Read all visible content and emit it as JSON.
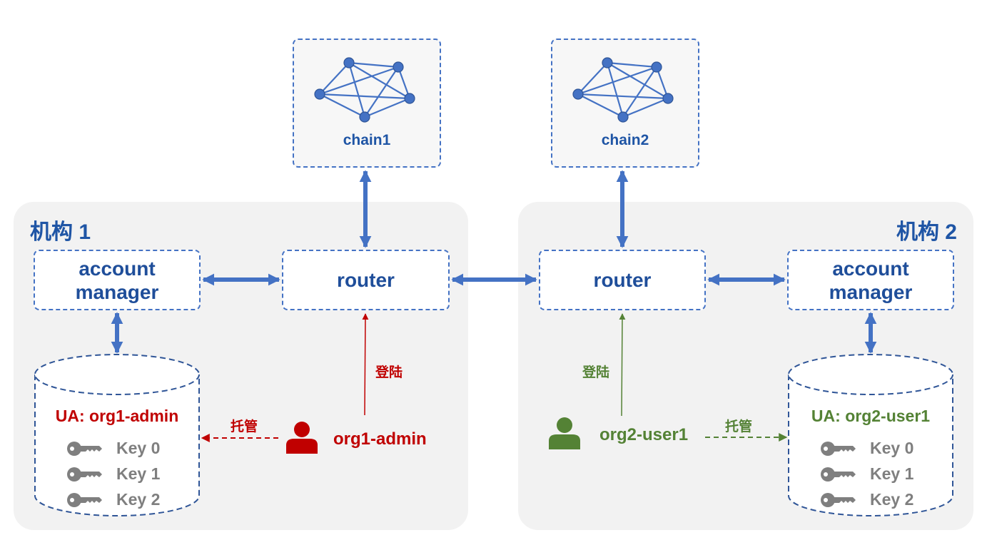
{
  "colors": {
    "primary_blue": "#4472c4",
    "text_blue": "#1f55a5",
    "org1_red": "#c00000",
    "org2_green": "#548235",
    "key_gray": "#7f7f7f",
    "panel_bg": "#f2f2f2"
  },
  "chains": [
    {
      "label": "chain1",
      "icon": "network-graph-icon"
    },
    {
      "label": "chain2",
      "icon": "network-graph-icon"
    }
  ],
  "orgs": [
    {
      "title": "机构 1",
      "router_label": "router",
      "account_manager_label": [
        "account",
        "manager"
      ],
      "user": {
        "name": "org1-admin",
        "icon": "user-icon",
        "color": "#c00000"
      },
      "login_label": "登陆",
      "custody_label": "托管",
      "ua": {
        "title": "UA: org1-admin",
        "keys": [
          {
            "label": "Key 0",
            "icon": "key-icon"
          },
          {
            "label": "Key 1",
            "icon": "key-icon"
          },
          {
            "label": "Key 2",
            "icon": "key-icon"
          }
        ]
      }
    },
    {
      "title": "机构 2",
      "router_label": "router",
      "account_manager_label": [
        "account",
        "manager"
      ],
      "user": {
        "name": "org2-user1",
        "icon": "user-icon",
        "color": "#548235"
      },
      "login_label": "登陆",
      "custody_label": "托管",
      "ua": {
        "title": "UA: org2-user1",
        "keys": [
          {
            "label": "Key 0",
            "icon": "key-icon"
          },
          {
            "label": "Key 1",
            "icon": "key-icon"
          },
          {
            "label": "Key 2",
            "icon": "key-icon"
          }
        ]
      }
    }
  ]
}
